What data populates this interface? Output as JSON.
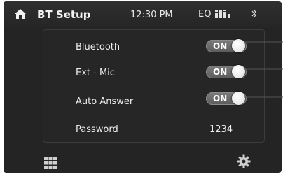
{
  "header": {
    "title": "BT Setup",
    "time": "12:30 PM",
    "eq_label": "EQ",
    "home_icon": "home-icon",
    "bluetooth_icon": "bluetooth-icon"
  },
  "settings": [
    {
      "label": "Bluetooth",
      "value": "ON"
    },
    {
      "label": "Ext - Mic",
      "value": "ON"
    },
    {
      "label": "Auto Answer",
      "value": "ON"
    },
    {
      "label": "Password",
      "value": "1234"
    }
  ],
  "footer": {
    "menu_icon": "apps-grid-icon",
    "settings_icon": "gear-icon"
  },
  "colors": {
    "background": "#242424",
    "text": "#eeeeee",
    "toggle": "#6e6e6e"
  }
}
